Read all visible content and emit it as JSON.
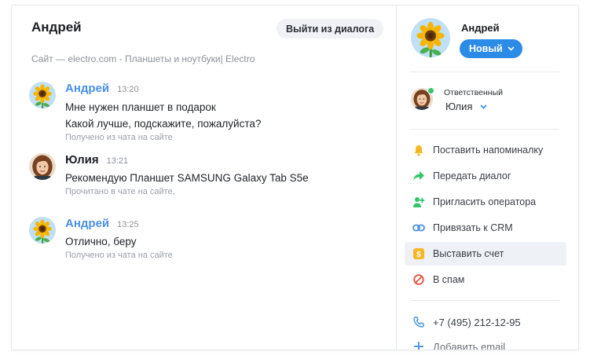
{
  "chat": {
    "title": "Андрей",
    "exit_label": "Выйти из диалога",
    "subtitle": "Сайт — electro.com - Планшеты и ноутбуки| Electro"
  },
  "messages": [
    {
      "name": "Андрей",
      "time": "13:20",
      "lines": [
        "Мне нужен планшет в подарок",
        "Какой лучше, подскажите, пожалуйста?"
      ],
      "status": "Получено из чата на сайте"
    },
    {
      "name": "Юлия",
      "time": "13:21",
      "lines": [
        "Рекомендую Планшет SAMSUNG Galaxy Tab S5e"
      ],
      "status": "Прочитано в чате на сайте,"
    },
    {
      "name": "Андрей",
      "time": "13:25",
      "lines": [
        "Отлично, беру"
      ],
      "status": "Получено из чата на сайте"
    }
  ],
  "client": {
    "name": "Андрей",
    "status_badge": "Новый"
  },
  "responsible": {
    "label": "Ответственный",
    "name": "Юлия"
  },
  "actions": [
    {
      "label": "Поставить напоминалку",
      "icon": "bell-icon",
      "color": "#f5b825"
    },
    {
      "label": "Передать диалог",
      "icon": "forward-arrow-icon",
      "color": "#35c46b"
    },
    {
      "label": "Пригласить оператора",
      "icon": "add-user-icon",
      "color": "#35c46b"
    },
    {
      "label": "Привязать к CRM",
      "icon": "link-icon",
      "color": "#4a90e2"
    },
    {
      "label": "Выставить счет",
      "icon": "dollar-icon",
      "color": "#f5b825"
    },
    {
      "label": "В спам",
      "icon": "block-icon",
      "color": "#e5533d"
    }
  ],
  "contacts": {
    "phone": "+7 (495) 212-12-95",
    "add_email": "Добавить email"
  },
  "colors": {
    "accent": "#2b8be6",
    "client_name": "#4a90e2",
    "online": "#35c46b"
  }
}
